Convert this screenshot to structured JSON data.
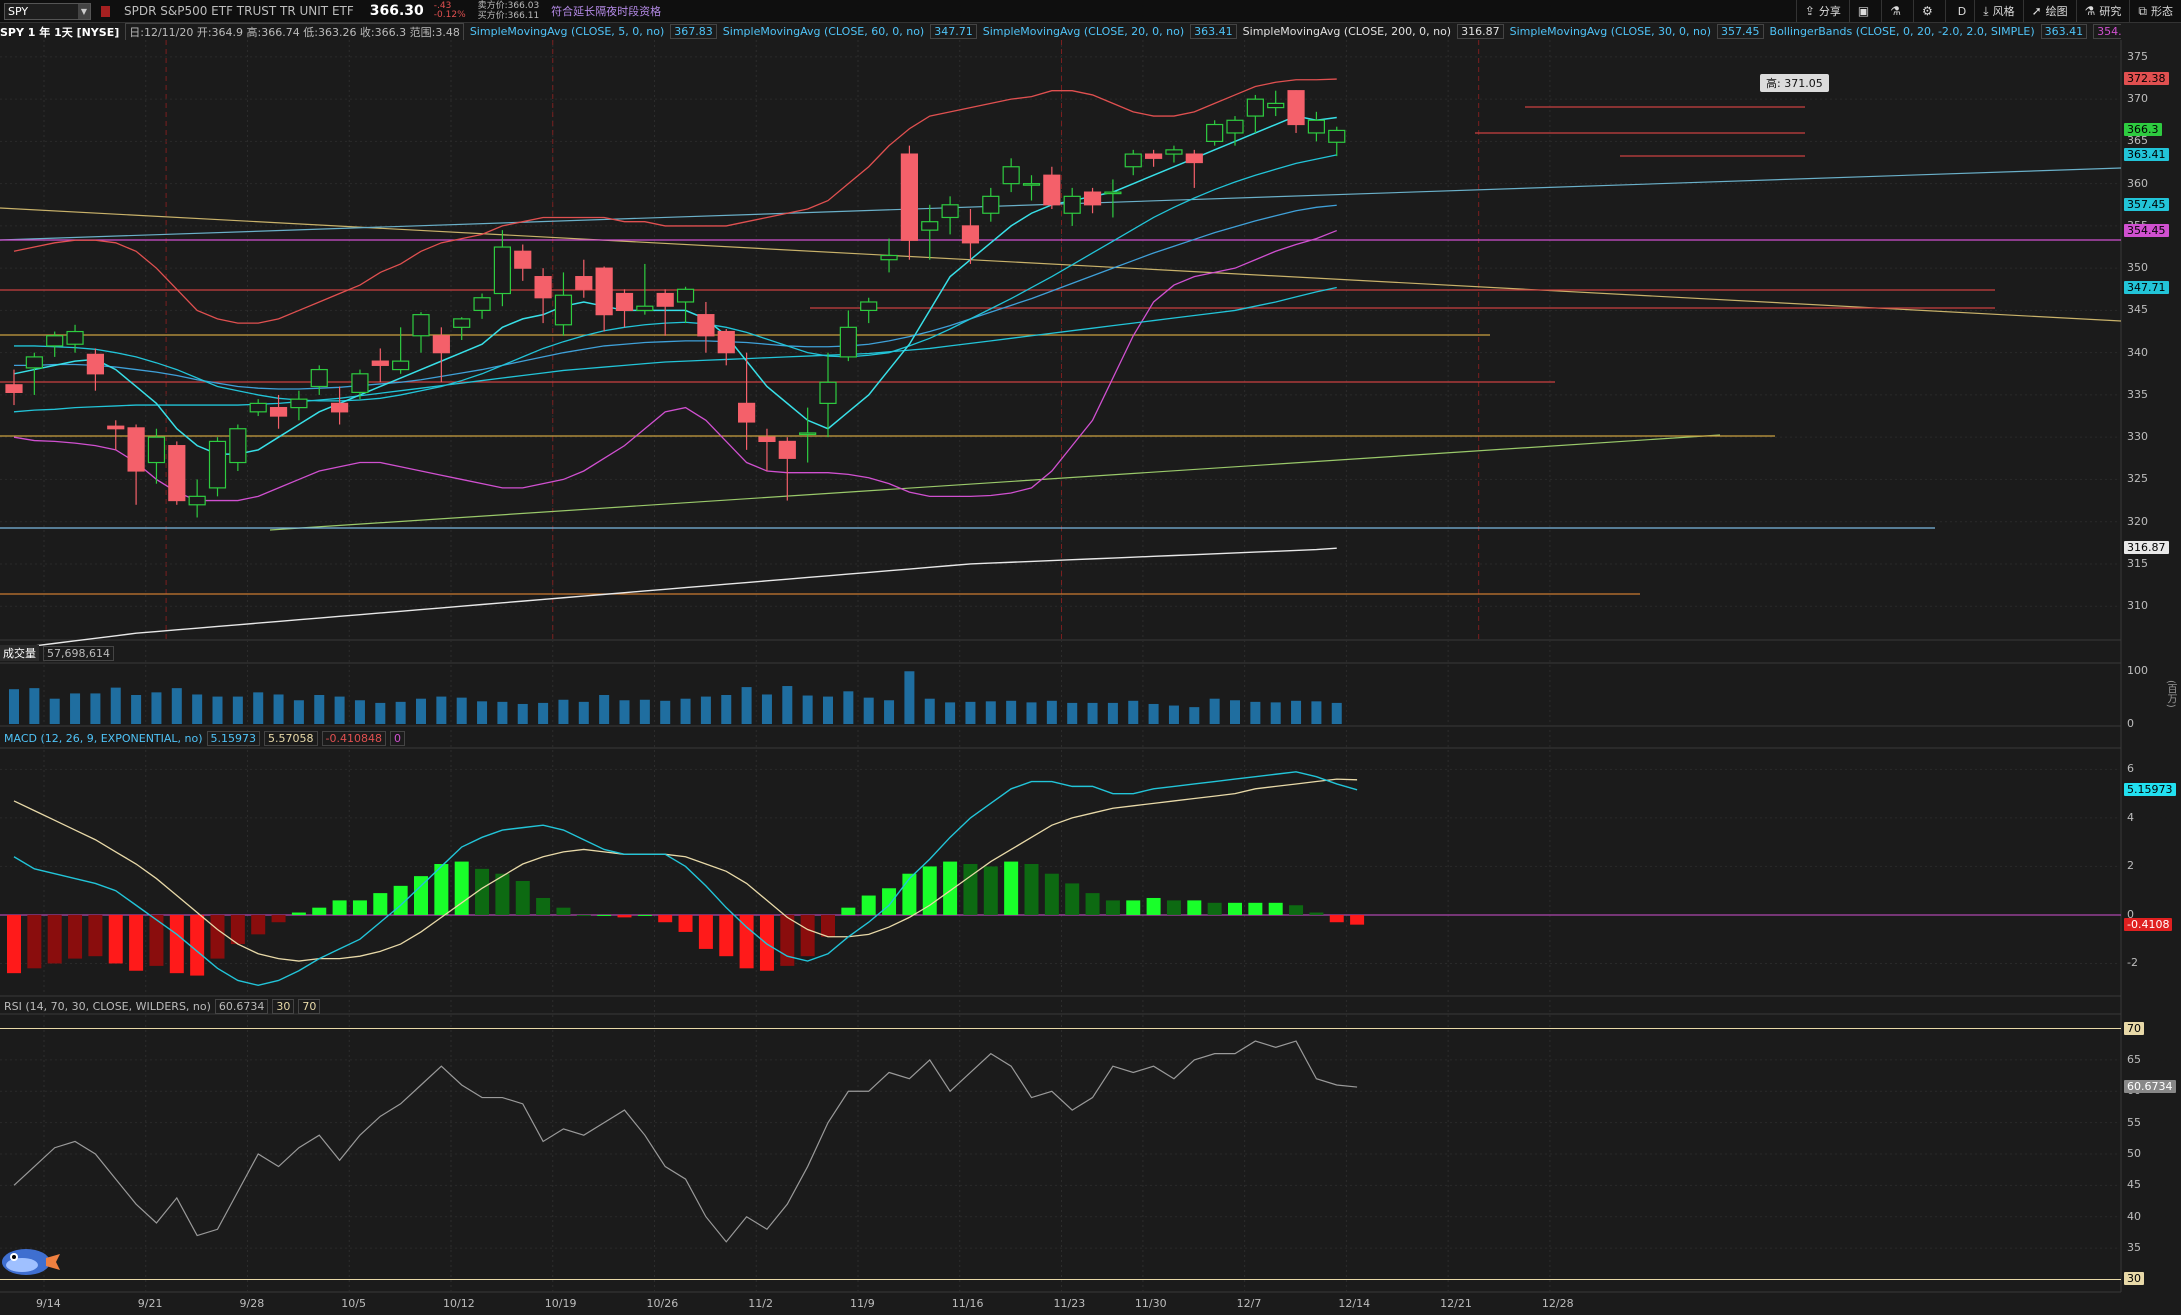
{
  "topbar": {
    "symbol": "SPY",
    "description": "SPDR S&P500 ETF TRUST TR UNIT ETF",
    "last": "366.30",
    "change": "-.43",
    "change_pct": "-0.12%",
    "bid": "卖方价:366.03",
    "ask": "买方价:366.11",
    "extended": "符合延长隔夜时段资格",
    "tools": [
      {
        "icon": "share-icon",
        "label": "分享"
      },
      {
        "icon": "screenshot-icon",
        "label": ""
      },
      {
        "icon": "flask-icon",
        "label": ""
      },
      {
        "icon": "gear-icon",
        "label": ""
      },
      {
        "icon": "period-icon",
        "label": "D"
      },
      {
        "icon": "style-icon",
        "label": "风格"
      },
      {
        "icon": "drawing-icon",
        "label": "绘图"
      },
      {
        "icon": "study-icon",
        "label": "研究"
      },
      {
        "icon": "pattern-icon",
        "label": "形态"
      }
    ]
  },
  "studybar": {
    "title": "SPY 1 年 1天 [NYSE]",
    "ohlc": "日:12/11/20 开:364.9 高:366.74 低:363.26 收:366.3 范围:3.48",
    "studies": [
      {
        "name": "SimpleMovingAvg (CLOSE, 5, 0, no)",
        "value": "367.83",
        "color": "#4fc3f7"
      },
      {
        "name": "SimpleMovingAvg (CLOSE, 60, 0, no)",
        "value": "347.71",
        "color": "#4fc3f7"
      },
      {
        "name": "SimpleMovingAvg (CLOSE, 20, 0, no)",
        "value": "363.41",
        "color": "#4fc3f7"
      },
      {
        "name": "SimpleMovingAvg (CLOSE, 200, 0, no)",
        "value": "316.87",
        "color": "#e0e0e0"
      },
      {
        "name": "SimpleMovingAvg (CLOSE, 30, 0, no)",
        "value": "357.45",
        "color": "#4fc3f7"
      },
      {
        "name": "BollingerBands (CLOSE, 0, 20, -2.0, 2.0, SIMPLE)",
        "value": "363.41",
        "lower": "354.45",
        "upper": "372.38",
        "color": "#4fc3f7"
      }
    ]
  },
  "price_axis": [
    "375",
    "370",
    "365",
    "360",
    "355",
    "350",
    "345",
    "340",
    "335",
    "330",
    "325",
    "320",
    "315",
    "310"
  ],
  "price_tags": [
    {
      "text": "372.38",
      "bg": "#e05050",
      "fg": "#000"
    },
    {
      "text": "366.3",
      "bg": "#2ecc40",
      "fg": "#000"
    },
    {
      "text": "363.41",
      "bg": "#22c4d8",
      "fg": "#000"
    },
    {
      "text": "357.45",
      "bg": "#22c4d8",
      "fg": "#000"
    },
    {
      "text": "354.45",
      "bg": "#d050d0",
      "fg": "#000"
    },
    {
      "text": "347.71",
      "bg": "#22c4d8",
      "fg": "#000"
    },
    {
      "text": "316.87",
      "bg": "#e8e8e8",
      "fg": "#000"
    }
  ],
  "high_label": "高: 371.05",
  "logo": "SPDRs",
  "volume": {
    "title": "成交量",
    "value": "57,698,614",
    "axis": [
      "100",
      "0"
    ],
    "unit": "(百万)"
  },
  "macd": {
    "title": "MACD (12, 26, 9, EXPONENTIAL, no)",
    "v1": "5.15973",
    "v2": "5.57058",
    "v3": "-0.410848",
    "v4": "0",
    "axis": [
      "6",
      "4",
      "2",
      "0",
      "-2"
    ],
    "tag_pos": "5.15973",
    "tag_neg": "-0.4108"
  },
  "rsi": {
    "title": "RSI (14, 70, 30, CLOSE, WILDERS, no)",
    "value": "60.6734",
    "ob": "30",
    "os": "70",
    "axis": [
      "65",
      "60",
      "55",
      "50",
      "45",
      "40",
      "35"
    ],
    "tag_70": "70",
    "tag_val": "60.6734",
    "tag_30": "30"
  },
  "dates": [
    "9/14",
    "9/21",
    "9/28",
    "10/5",
    "10/12",
    "10/19",
    "10/26",
    "11/2",
    "11/9",
    "11/16",
    "11/23",
    "11/30",
    "12/7",
    "12/14",
    "12/21",
    "12/28"
  ],
  "chart_data": {
    "type": "candlestick",
    "candles": [
      [
        336.2,
        335.3,
        333.8,
        338.0
      ],
      [
        338.2,
        339.5,
        340.0,
        335.0
      ],
      [
        340.8,
        342.0,
        342.5,
        339.5
      ],
      [
        341.0,
        342.5,
        343.3,
        340.0
      ],
      [
        339.8,
        337.5,
        340.5,
        335.5
      ],
      [
        331.3,
        331.0,
        332.0,
        328.5
      ],
      [
        331.1,
        326.0,
        331.5,
        322.0
      ],
      [
        327.0,
        330.0,
        331.0,
        324.5
      ],
      [
        329.0,
        322.5,
        329.5,
        322.0
      ],
      [
        322.0,
        323.0,
        325.0,
        320.5
      ],
      [
        324.0,
        329.5,
        330.0,
        323.0
      ],
      [
        327.0,
        331.0,
        331.5,
        326.0
      ],
      [
        333.0,
        334.0,
        334.5,
        332.5
      ],
      [
        333.5,
        332.5,
        335.0,
        331.0
      ],
      [
        333.5,
        334.5,
        335.5,
        332.0
      ],
      [
        336.0,
        338.0,
        338.5,
        335.0
      ],
      [
        334.0,
        333.0,
        336.0,
        331.5
      ],
      [
        335.3,
        337.5,
        338.0,
        334.5
      ],
      [
        339.0,
        338.5,
        340.5,
        336.5
      ],
      [
        338.0,
        339.0,
        343.0,
        337.5
      ],
      [
        342.0,
        344.5,
        344.8,
        340.0
      ],
      [
        342.0,
        340.0,
        343.0,
        336.5
      ],
      [
        343.0,
        344.0,
        344.2,
        341.5
      ],
      [
        345.0,
        346.5,
        347.0,
        344.0
      ],
      [
        347.0,
        352.5,
        354.5,
        345.5
      ],
      [
        352.0,
        350.0,
        352.8,
        348.5
      ],
      [
        349.0,
        346.5,
        350.0,
        343.5
      ],
      [
        343.3,
        346.8,
        349.5,
        342.0
      ],
      [
        349.0,
        347.5,
        351.0,
        346.5
      ],
      [
        350.0,
        344.5,
        350.2,
        342.5
      ],
      [
        347.0,
        345.0,
        347.5,
        343.0
      ],
      [
        345.0,
        345.5,
        350.5,
        344.5
      ],
      [
        347.0,
        345.5,
        347.5,
        342.0
      ],
      [
        346.0,
        347.5,
        347.8,
        343.5
      ],
      [
        344.5,
        342.0,
        346.0,
        340.0
      ],
      [
        342.5,
        340.0,
        342.8,
        338.5
      ],
      [
        334.0,
        331.8,
        340.0,
        328.5
      ],
      [
        330.0,
        329.5,
        331.0,
        326.0
      ],
      [
        329.5,
        327.5,
        330.0,
        322.5
      ],
      [
        330.5,
        330.5,
        333.5,
        327.0
      ],
      [
        334.0,
        336.5,
        340.0,
        330.0
      ],
      [
        339.5,
        343.0,
        345.0,
        339.0
      ],
      [
        345.0,
        346.0,
        346.5,
        343.5
      ],
      [
        351.0,
        351.5,
        353.5,
        349.5
      ],
      [
        363.5,
        353.3,
        364.5,
        351.0
      ],
      [
        354.5,
        355.5,
        357.5,
        351.0
      ],
      [
        356.0,
        357.5,
        358.5,
        354.0
      ],
      [
        355.0,
        353.0,
        357.0,
        350.5
      ],
      [
        356.5,
        358.5,
        359.5,
        355.5
      ],
      [
        360.0,
        362.0,
        363.0,
        359.0
      ],
      [
        360.0,
        360.0,
        361.0,
        358.0
      ],
      [
        361.0,
        357.5,
        362.0,
        357.0
      ],
      [
        356.5,
        358.5,
        359.5,
        355.0
      ],
      [
        359.0,
        357.5,
        359.5,
        356.5
      ],
      [
        359.0,
        359.0,
        360.5,
        356.0
      ],
      [
        362.0,
        363.5,
        364.0,
        361.0
      ],
      [
        363.5,
        363.0,
        364.0,
        362.0
      ],
      [
        363.5,
        364.0,
        364.5,
        362.5
      ],
      [
        363.5,
        362.5,
        364.0,
        359.5
      ],
      [
        365.0,
        367.0,
        367.5,
        364.5
      ],
      [
        366.0,
        367.5,
        368.0,
        364.5
      ],
      [
        368.0,
        370.0,
        370.5,
        366.0
      ],
      [
        369.0,
        369.5,
        371.0,
        368.0
      ],
      [
        371.0,
        367.0,
        371.05,
        366.0
      ],
      [
        366.0,
        367.5,
        368.5,
        365.0
      ],
      [
        364.9,
        366.3,
        366.74,
        363.26
      ]
    ],
    "volume": [
      66,
      68,
      48,
      58,
      58,
      69,
      55,
      60,
      68,
      56,
      52,
      52,
      60,
      56,
      45,
      55,
      52,
      45,
      40,
      42,
      48,
      52,
      50,
      43,
      42,
      38,
      40,
      46,
      42,
      55,
      45,
      46,
      44,
      48,
      52,
      55,
      70,
      56,
      72,
      54,
      52,
      62,
      50,
      45,
      100,
      48,
      41,
      42,
      43,
      44,
      41,
      44,
      40,
      40,
      40,
      44,
      38,
      35,
      32,
      48,
      45,
      42,
      41,
      44,
      43,
      40
    ],
    "macd_hist": [
      -2.4,
      -2.2,
      -2.0,
      -1.8,
      -1.7,
      -2.0,
      -2.3,
      -2.1,
      -2.4,
      -2.5,
      -1.8,
      -1.2,
      -0.8,
      -0.3,
      0.1,
      0.3,
      0.6,
      0.6,
      0.9,
      1.2,
      1.6,
      2.1,
      2.2,
      1.9,
      1.7,
      1.4,
      0.7,
      0.3,
      0.0,
      0.0,
      -0.1,
      0.0,
      -0.3,
      -0.7,
      -1.4,
      -1.7,
      -2.2,
      -2.3,
      -2.1,
      -1.7,
      -0.9,
      0.3,
      0.8,
      1.1,
      1.7,
      2.0,
      2.2,
      2.1,
      2.0,
      2.2,
      2.1,
      1.7,
      1.3,
      0.9,
      0.6,
      0.6,
      0.7,
      0.6,
      0.6,
      0.5,
      0.5,
      0.5,
      0.5,
      0.4,
      0.1,
      -0.3,
      -0.4
    ],
    "macd_line": [
      2.4,
      1.9,
      1.7,
      1.5,
      1.3,
      1.0,
      0.4,
      -0.2,
      -0.8,
      -1.5,
      -2.2,
      -2.7,
      -2.9,
      -2.7,
      -2.3,
      -1.8,
      -1.4,
      -1.0,
      -0.3,
      0.4,
      1.2,
      2.0,
      2.8,
      3.2,
      3.5,
      3.6,
      3.7,
      3.5,
      3.1,
      2.7,
      2.5,
      2.5,
      2.5,
      2.0,
      1.2,
      0.3,
      -0.5,
      -1.2,
      -1.7,
      -1.9,
      -1.6,
      -0.9,
      -0.3,
      0.4,
      1.5,
      2.3,
      3.2,
      4.0,
      4.6,
      5.2,
      5.5,
      5.5,
      5.3,
      5.3,
      5.0,
      5.0,
      5.2,
      5.3,
      5.4,
      5.5,
      5.6,
      5.7,
      5.8,
      5.9,
      5.7,
      5.4,
      5.16
    ],
    "signal_line": [
      4.7,
      4.3,
      3.9,
      3.5,
      3.1,
      2.6,
      2.1,
      1.5,
      0.8,
      0.1,
      -0.6,
      -1.2,
      -1.6,
      -1.8,
      -1.9,
      -1.8,
      -1.8,
      -1.7,
      -1.5,
      -1.2,
      -0.7,
      -0.1,
      0.5,
      1.1,
      1.6,
      2.1,
      2.4,
      2.6,
      2.7,
      2.6,
      2.5,
      2.5,
      2.5,
      2.4,
      2.1,
      1.8,
      1.3,
      0.6,
      -0.1,
      -0.6,
      -0.9,
      -0.9,
      -0.8,
      -0.5,
      -0.1,
      0.4,
      1.0,
      1.6,
      2.2,
      2.7,
      3.2,
      3.7,
      4.0,
      4.2,
      4.4,
      4.5,
      4.6,
      4.7,
      4.8,
      4.9,
      5.0,
      5.2,
      5.3,
      5.4,
      5.5,
      5.6,
      5.57
    ],
    "rsi": [
      45,
      48,
      51,
      52,
      50,
      46,
      42,
      39,
      43,
      37,
      38,
      44,
      50,
      48,
      51,
      53,
      49,
      53,
      56,
      58,
      61,
      64,
      61,
      59,
      59,
      58,
      52,
      54,
      53,
      55,
      57,
      53,
      48,
      46,
      40,
      36,
      40,
      38,
      42,
      48,
      55,
      60,
      60,
      63,
      62,
      65,
      60,
      63,
      66,
      64,
      59,
      60,
      57,
      59,
      64,
      63,
      64,
      62,
      65,
      66,
      66,
      68,
      67,
      68,
      62,
      61,
      60.67
    ],
    "sma5": [
      337.5,
      338,
      338.5,
      339,
      339.2,
      338,
      336,
      334,
      331,
      329,
      328,
      328,
      328.5,
      330,
      331.5,
      333,
      334,
      335,
      336,
      337,
      338,
      339,
      340,
      341,
      343,
      344,
      344.5,
      345.5,
      346,
      345.5,
      345,
      345,
      345,
      345,
      344,
      342,
      339,
      336,
      334,
      332,
      331,
      333,
      335,
      338,
      341,
      345,
      349,
      351,
      353,
      355,
      356.5,
      357.5,
      358,
      358.5,
      359,
      360,
      361,
      362,
      363,
      364,
      365,
      366,
      367,
      368,
      367.5,
      367.83
    ],
    "sma20": [
      340.8,
      340.8,
      340.7,
      340.6,
      340.4,
      340,
      339.5,
      338.8,
      338,
      337,
      336,
      335.5,
      335,
      334.6,
      334.4,
      334.3,
      334.3,
      334.4,
      334.6,
      335,
      335.5,
      336,
      336.7,
      337.5,
      338.5,
      339.5,
      340.5,
      341.3,
      342,
      342.6,
      343,
      343.3,
      343.5,
      343.6,
      343.4,
      343,
      342.4,
      341.6,
      340.8,
      340,
      339.6,
      339.5,
      339.7,
      340,
      340.8,
      341.7,
      342.8,
      344,
      345.2,
      346.4,
      347.7,
      349,
      350.4,
      351.8,
      353.2,
      354.6,
      356,
      357.2,
      358.3,
      359.3,
      360.2,
      361,
      361.7,
      362.4,
      362.9,
      363.41
    ],
    "sma30": [
      338.5,
      338.5,
      338.6,
      338.6,
      338.5,
      338.3,
      338,
      337.7,
      337.3,
      336.8,
      336.4,
      336,
      335.8,
      335.7,
      335.7,
      335.8,
      335.9,
      336.1,
      336.3,
      336.5,
      336.8,
      337.2,
      337.6,
      338,
      338.5,
      339,
      339.5,
      340,
      340.4,
      340.8,
      341,
      341.2,
      341.3,
      341.4,
      341.4,
      341.3,
      341.2,
      341,
      340.8,
      340.7,
      340.7,
      340.8,
      341,
      341.4,
      341.9,
      342.5,
      343.2,
      344,
      344.8,
      345.6,
      346.4,
      347.3,
      348.2,
      349.1,
      350,
      350.9,
      351.8,
      352.6,
      353.4,
      354.2,
      354.9,
      355.6,
      356.2,
      356.8,
      357.2,
      357.45
    ],
    "sma60": [
      333,
      333.2,
      333.3,
      333.5,
      333.6,
      333.7,
      333.8,
      333.8,
      333.8,
      333.8,
      333.8,
      333.8,
      333.9,
      334,
      334.2,
      334.4,
      334.6,
      334.9,
      335.2,
      335.5,
      335.8,
      336.1,
      336.4,
      336.7,
      337,
      337.3,
      337.6,
      337.9,
      338.1,
      338.3,
      338.5,
      338.7,
      338.9,
      339,
      339.1,
      339.2,
      339.3,
      339.4,
      339.5,
      339.6,
      339.7,
      339.8,
      339.9,
      340.1,
      340.3,
      340.5,
      340.8,
      341.1,
      341.4,
      341.7,
      342,
      342.3,
      342.6,
      342.9,
      343.2,
      343.5,
      343.8,
      344.1,
      344.4,
      344.7,
      345,
      345.5,
      346,
      346.6,
      347.2,
      347.71
    ],
    "sma200": [
      305,
      305.3,
      305.6,
      305.9,
      306.2,
      306.5,
      306.8,
      307,
      307.2,
      307.4,
      307.6,
      307.8,
      308,
      308.2,
      308.4,
      308.6,
      308.8,
      309,
      309.2,
      309.4,
      309.6,
      309.8,
      310,
      310.2,
      310.4,
      310.6,
      310.8,
      311,
      311.2,
      311.4,
      311.6,
      311.8,
      312,
      312.2,
      312.4,
      312.6,
      312.8,
      313,
      313.2,
      313.4,
      313.6,
      313.8,
      314,
      314.2,
      314.4,
      314.6,
      314.8,
      315,
      315.1,
      315.2,
      315.3,
      315.4,
      315.5,
      315.6,
      315.7,
      315.8,
      315.9,
      316,
      316.1,
      316.2,
      316.3,
      316.4,
      316.5,
      316.6,
      316.7,
      316.87
    ],
    "bb_upper": [
      352,
      352.5,
      353,
      353.3,
      353.3,
      353,
      352,
      350,
      347.5,
      345,
      344,
      343.5,
      343.5,
      344,
      345,
      346,
      347,
      348,
      349.5,
      350.5,
      352,
      353,
      353.5,
      354,
      355,
      355.5,
      356,
      356,
      356,
      356,
      355.5,
      355.5,
      355,
      355,
      355,
      355,
      355.5,
      356,
      356.5,
      357,
      358,
      360,
      362,
      364.5,
      366.5,
      368,
      368.5,
      369,
      369.5,
      370,
      370.3,
      371,
      371,
      370.5,
      369.5,
      368.5,
      368,
      368,
      368.5,
      369.5,
      370.5,
      371.5,
      372,
      372.3,
      372.3,
      372.38
    ],
    "bb_lower": [
      330,
      329.6,
      329.5,
      329.3,
      329,
      328.5,
      327,
      325,
      323.5,
      322.5,
      322.5,
      322.5,
      323,
      324,
      325,
      326,
      326.5,
      327,
      327,
      326.5,
      326,
      325.5,
      325,
      324.5,
      324,
      324,
      324.5,
      325,
      326,
      327.5,
      329,
      331,
      333,
      333.5,
      332,
      329.5,
      327,
      326,
      325.8,
      325.8,
      325.8,
      325.6,
      325.2,
      324.5,
      323.5,
      323,
      323,
      323,
      323.1,
      323.4,
      324,
      326,
      329,
      332,
      337,
      342,
      346,
      348,
      349,
      349.5,
      350,
      351,
      352,
      352.8,
      353.5,
      354.45
    ]
  }
}
